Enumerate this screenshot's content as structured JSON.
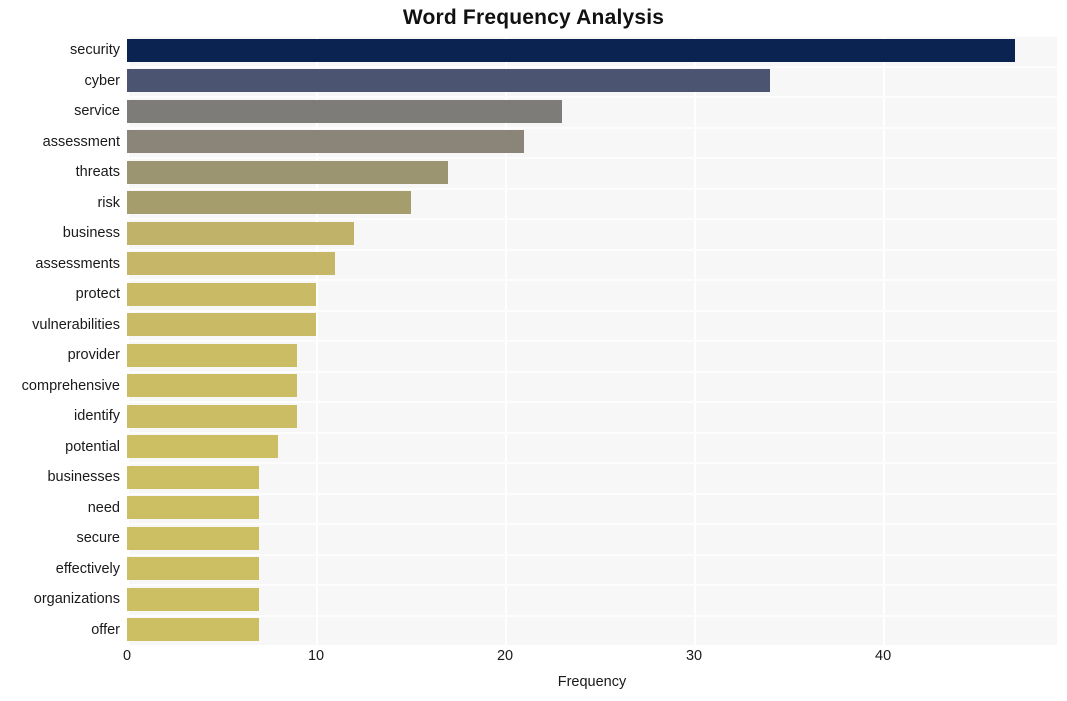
{
  "chart_data": {
    "type": "bar",
    "orientation": "horizontal",
    "title": "Word Frequency Analysis",
    "xlabel": "Frequency",
    "ylabel": "",
    "categories": [
      "security",
      "cyber",
      "service",
      "assessment",
      "threats",
      "risk",
      "business",
      "assessments",
      "protect",
      "vulnerabilities",
      "provider",
      "comprehensive",
      "identify",
      "potential",
      "businesses",
      "need",
      "secure",
      "effectively",
      "organizations",
      "offer"
    ],
    "values": [
      47,
      34,
      23,
      21,
      17,
      15,
      12,
      11,
      10,
      10,
      9,
      9,
      9,
      8,
      7,
      7,
      7,
      7,
      7,
      7
    ],
    "bar_colors": [
      "#0a2351",
      "#4b5470",
      "#7d7c78",
      "#8a8578",
      "#9c9572",
      "#a69d6c",
      "#c0b269",
      "#c5b767",
      "#c9bb66",
      "#c9bb66",
      "#cbbd64",
      "#cbbd64",
      "#cbbd64",
      "#ccbe63",
      "#ccbe63",
      "#ccbe63",
      "#ccbe63",
      "#ccbe63",
      "#ccbe63",
      "#ccbe63"
    ],
    "xlim": [
      0,
      49.2
    ],
    "xticks": [
      0,
      10,
      20,
      30,
      40
    ],
    "xtick_labels": [
      "0",
      "10",
      "20",
      "30",
      "40"
    ],
    "grid": true,
    "grid_color": "#ffffff",
    "plot_background": "#f7f7f7",
    "figure_background": "#ffffff",
    "legend": null
  }
}
